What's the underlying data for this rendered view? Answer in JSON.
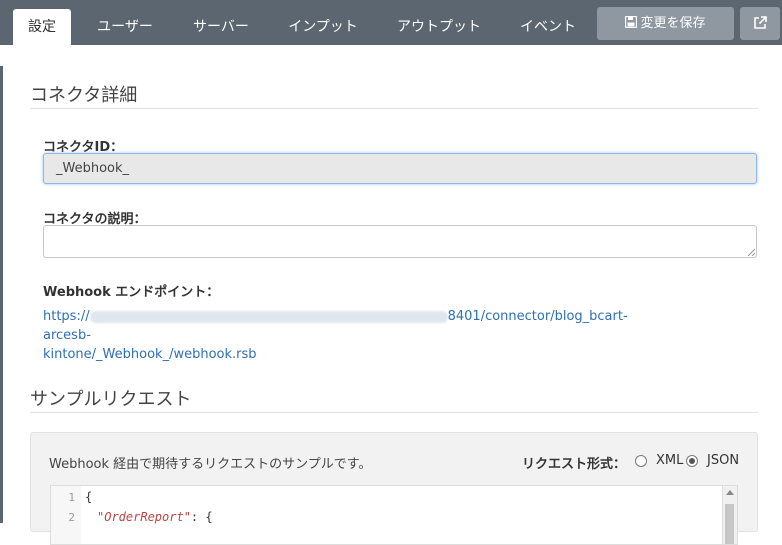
{
  "tabs": [
    {
      "label": "設定"
    },
    {
      "label": "ユーザー"
    },
    {
      "label": "サーバー"
    },
    {
      "label": "インプット"
    },
    {
      "label": "アウトプット"
    },
    {
      "label": "イベント"
    }
  ],
  "toolbar": {
    "save_label": "変更を保存"
  },
  "connector": {
    "section_title": "コネクタ詳細",
    "id_label": "コネクタID：",
    "id_value": "_Webhook_",
    "desc_label": "コネクタの説明：",
    "desc_value": "",
    "endpoint_label": "Webhook エンドポイント：",
    "endpoint_prefix": "https://",
    "endpoint_suffix_line1": "8401/connector/blog_bcart-arcesb-",
    "endpoint_line2": "kintone/_Webhook_/webhook.rsb"
  },
  "sample": {
    "section_title": "サンプルリクエスト",
    "description": "Webhook 経由で期待するリクエストのサンプルです。",
    "format_label": "リクエスト形式：",
    "format_options": [
      "XML",
      "JSON"
    ],
    "format_selected": "JSON",
    "code_lines": [
      {
        "num": "1",
        "text": "{"
      },
      {
        "num": "2",
        "key": "\"OrderReport\"",
        "rest": ": {"
      }
    ]
  }
}
